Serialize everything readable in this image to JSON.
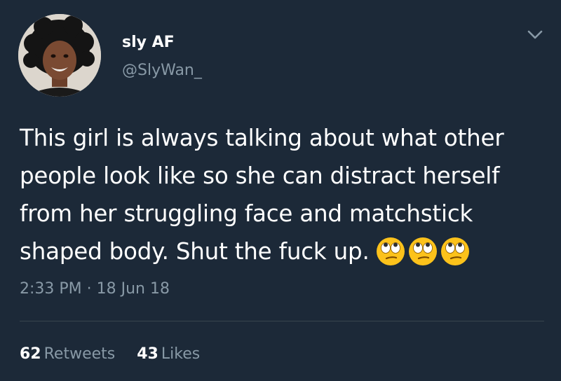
{
  "tweet": {
    "author": {
      "display_name": "sly AF",
      "handle": "@SlyWan_",
      "avatar": "profile-photo"
    },
    "menu_icon": "chevron-down-icon",
    "text": "This girl is always talking about what other people look like so she can distract herself from her struggling face and matchstick shaped body. Shut the fuck up.",
    "emojis": [
      "face-with-rolling-eyes-emoji",
      "face-with-rolling-eyes-emoji",
      "face-with-rolling-eyes-emoji"
    ],
    "timestamp": "2:33 PM · 18 Jun 18",
    "stats": {
      "retweets_count": "62",
      "retweets_label": "Retweets",
      "likes_count": "43",
      "likes_label": "Likes"
    }
  },
  "colors": {
    "background": "#1c2938",
    "primary_text": "#ffffff",
    "secondary_text": "#8899a6",
    "divider": "#38444d"
  }
}
